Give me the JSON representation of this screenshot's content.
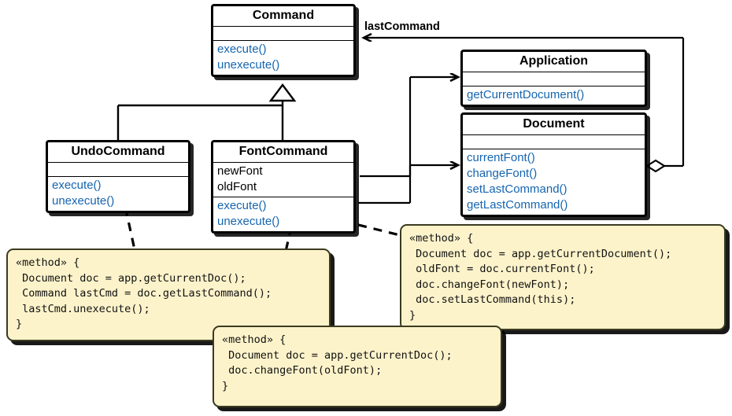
{
  "diagram": {
    "title": "Command pattern UML class diagram",
    "colors": {
      "operation_text": "#1565b0",
      "note_fill": "#fdf3cb",
      "note_border": "#3b3b20",
      "class_border": "#000000",
      "background": "#ffffff"
    }
  },
  "classes": [
    {
      "id": "command",
      "name": "Command",
      "attributes": [],
      "operations": [
        "execute()",
        "unexecute()"
      ]
    },
    {
      "id": "undocommand",
      "name": "UndoCommand",
      "attributes": [],
      "operations": [
        "execute()",
        "unexecute()"
      ]
    },
    {
      "id": "fontcommand",
      "name": "FontCommand",
      "attributes": [
        "newFont",
        "oldFont"
      ],
      "operations": [
        "execute()",
        "unexecute()"
      ]
    },
    {
      "id": "application",
      "name": "Application",
      "attributes": [],
      "operations": [
        "getCurrentDocument()"
      ]
    },
    {
      "id": "document",
      "name": "Document",
      "attributes": [],
      "operations": [
        "currentFont()",
        "changeFont()",
        "setLastCommand()",
        "getLastCommand()"
      ]
    }
  ],
  "edge_labels": {
    "last_command": "lastCommand"
  },
  "notes": [
    {
      "id": "note-undo-execute",
      "lines": [
        "«method» {",
        " Document doc = app.getCurrentDoc();",
        " Command lastCmd = doc.getLastCommand();",
        " lastCmd.unexecute();",
        "}"
      ]
    },
    {
      "id": "note-font-unexecute",
      "lines": [
        "«method» {",
        " Document doc = app.getCurrentDoc();",
        " doc.changeFont(oldFont);",
        "}"
      ]
    },
    {
      "id": "note-font-execute",
      "lines": [
        "«method» {",
        " Document doc = app.getCurrentDocument();",
        " oldFont = doc.currentFont();",
        " doc.changeFont(newFont);",
        " doc.setLastCommand(this);",
        "}"
      ]
    }
  ]
}
